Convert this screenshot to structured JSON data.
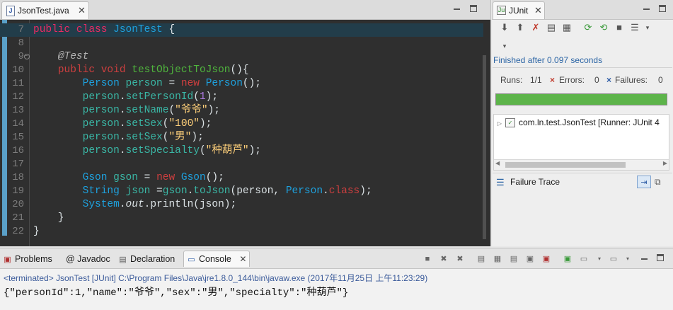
{
  "editor": {
    "tab_label": "JsonTest.java",
    "lines": [
      {
        "n": "7",
        "segs": [
          [
            "kw",
            "public"
          ],
          [
            "p",
            " "
          ],
          [
            "kw",
            "class"
          ],
          [
            "p",
            " "
          ],
          [
            "ty",
            "JsonTest"
          ],
          [
            "p",
            " {"
          ]
        ]
      },
      {
        "n": "8",
        "segs": []
      },
      {
        "n": "9",
        "segs": [
          [
            "p",
            "    "
          ],
          [
            "ann",
            "@Test"
          ]
        ]
      },
      {
        "n": "10",
        "segs": [
          [
            "p",
            "    "
          ],
          [
            "kw2",
            "public"
          ],
          [
            "p",
            " "
          ],
          [
            "kw2",
            "void"
          ],
          [
            "p",
            " "
          ],
          [
            "meth",
            "testObjectToJson"
          ],
          [
            "p",
            "(){"
          ]
        ]
      },
      {
        "n": "11",
        "segs": [
          [
            "p",
            "        "
          ],
          [
            "ty",
            "Person"
          ],
          [
            "p",
            " "
          ],
          [
            "ty2",
            "person"
          ],
          [
            "p",
            " = "
          ],
          [
            "kw2",
            "new"
          ],
          [
            "p",
            " "
          ],
          [
            "ty",
            "Person"
          ],
          [
            "p",
            "();"
          ]
        ]
      },
      {
        "n": "12",
        "segs": [
          [
            "p",
            "        "
          ],
          [
            "ty2",
            "person"
          ],
          [
            "p",
            "."
          ],
          [
            "ty2",
            "setPersonId"
          ],
          [
            "p",
            "("
          ],
          [
            "num",
            "1"
          ],
          [
            "p",
            ");"
          ]
        ]
      },
      {
        "n": "13",
        "segs": [
          [
            "p",
            "        "
          ],
          [
            "ty2",
            "person"
          ],
          [
            "p",
            "."
          ],
          [
            "ty2",
            "setName"
          ],
          [
            "p",
            "("
          ],
          [
            "strg",
            "\"爷爷\""
          ],
          [
            "p",
            ");"
          ]
        ]
      },
      {
        "n": "14",
        "segs": [
          [
            "p",
            "        "
          ],
          [
            "ty2",
            "person"
          ],
          [
            "p",
            "."
          ],
          [
            "ty2",
            "setSex"
          ],
          [
            "p",
            "("
          ],
          [
            "strg",
            "\"100\""
          ],
          [
            "p",
            ");"
          ]
        ]
      },
      {
        "n": "15",
        "segs": [
          [
            "p",
            "        "
          ],
          [
            "ty2",
            "person"
          ],
          [
            "p",
            "."
          ],
          [
            "ty2",
            "setSex"
          ],
          [
            "p",
            "("
          ],
          [
            "strg",
            "\"男\""
          ],
          [
            "p",
            ");"
          ]
        ]
      },
      {
        "n": "16",
        "segs": [
          [
            "p",
            "        "
          ],
          [
            "ty2",
            "person"
          ],
          [
            "p",
            "."
          ],
          [
            "ty2",
            "setSpecialty"
          ],
          [
            "p",
            "("
          ],
          [
            "strg",
            "\"种葫芦\""
          ],
          [
            "p",
            ");"
          ]
        ]
      },
      {
        "n": "17",
        "segs": []
      },
      {
        "n": "18",
        "segs": [
          [
            "p",
            "        "
          ],
          [
            "ty",
            "Gson"
          ],
          [
            "p",
            " "
          ],
          [
            "ty2",
            "gson"
          ],
          [
            "p",
            " = "
          ],
          [
            "kw2",
            "new"
          ],
          [
            "p",
            " "
          ],
          [
            "ty",
            "Gson"
          ],
          [
            "p",
            "();"
          ]
        ]
      },
      {
        "n": "19",
        "segs": [
          [
            "p",
            "        "
          ],
          [
            "ty",
            "String"
          ],
          [
            "p",
            " "
          ],
          [
            "ty2",
            "json"
          ],
          [
            "p",
            " ="
          ],
          [
            "ty2",
            "gson"
          ],
          [
            "p",
            "."
          ],
          [
            "ty2",
            "toJson"
          ],
          [
            "p",
            "(person, "
          ],
          [
            "ty",
            "Person"
          ],
          [
            "p",
            "."
          ],
          [
            "kw2",
            "class"
          ],
          [
            "p",
            ");"
          ]
        ]
      },
      {
        "n": "20",
        "segs": [
          [
            "p",
            "        "
          ],
          [
            "ty",
            "System"
          ],
          [
            "p",
            "."
          ],
          [
            "it",
            "out"
          ],
          [
            "p",
            "."
          ],
          [
            "p",
            "println(json);"
          ]
        ]
      },
      {
        "n": "21",
        "segs": [
          [
            "p",
            "    }"
          ]
        ]
      },
      {
        "n": "22",
        "segs": [
          [
            "p",
            "}"
          ]
        ]
      }
    ]
  },
  "junit": {
    "tab_label": "JUnit",
    "finished": "Finished after 0.097 seconds",
    "runs_label": "Runs:",
    "runs_value": "1/1",
    "errors_label": "Errors:",
    "errors_value": "0",
    "failures_label": "Failures:",
    "failures_value": "0",
    "progress": 1.0,
    "progress_color": "#5db44a",
    "tree_item": "com.ln.test.JsonTest [Runner: JUnit 4",
    "failure_trace_label": "Failure Trace"
  },
  "console": {
    "tabs": [
      {
        "label": "Problems",
        "icon": "problems-icon"
      },
      {
        "label": "@ Javadoc",
        "icon": "javadoc-icon"
      },
      {
        "label": "Declaration",
        "icon": "declaration-icon"
      },
      {
        "label": "Console",
        "icon": "console-icon"
      }
    ],
    "status": "<terminated> JsonTest [JUnit] C:\\Program Files\\Java\\jre1.8.0_144\\bin\\javaw.exe (2017年11月25日 上午11:23:29)",
    "output": "{\"personId\":1,\"name\":\"爷爷\",\"sex\":\"男\",\"specialty\":\"种葫芦\"}"
  }
}
